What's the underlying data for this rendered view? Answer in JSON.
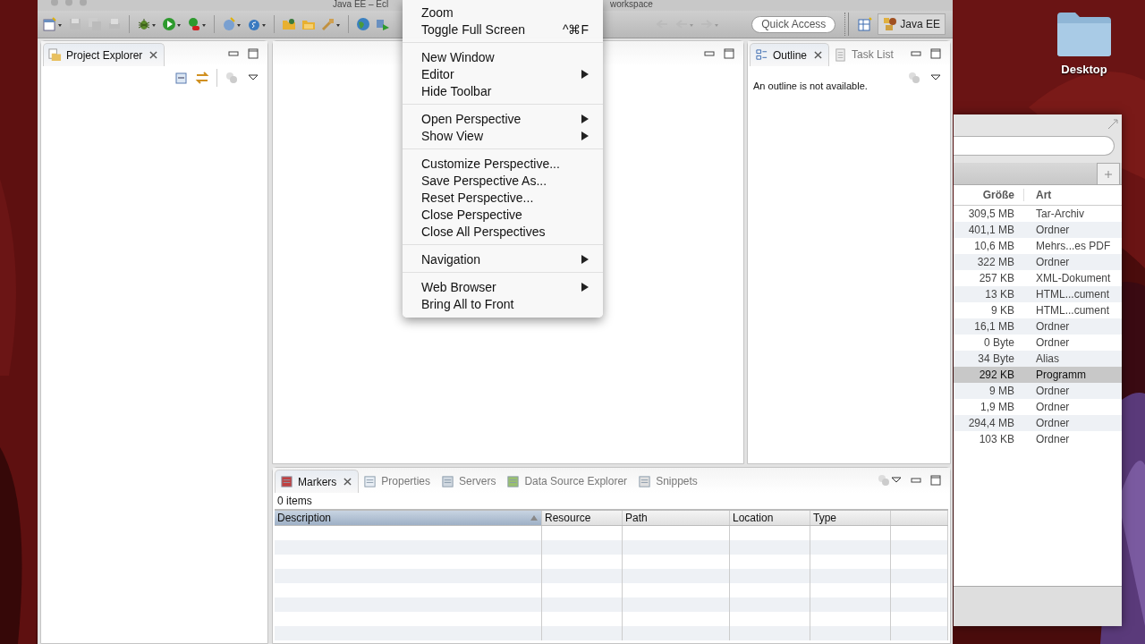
{
  "window": {
    "title_parts": [
      "Java EE – Ecl",
      "workspace"
    ]
  },
  "toolbar": {
    "quick_access": {
      "placeholder": "Quick Access"
    },
    "perspective": {
      "label": "Java EE",
      "selected": true
    }
  },
  "project_explorer": {
    "tabs": [
      {
        "label": "Project Explorer",
        "selected": true
      }
    ]
  },
  "outline": {
    "tabs": [
      {
        "label": "Outline",
        "selected": true
      },
      {
        "label": "Task List",
        "selected": false
      }
    ],
    "message": "An outline is not available."
  },
  "bottom": {
    "tabs": [
      {
        "label": "Markers",
        "selected": true
      },
      {
        "label": "Properties",
        "selected": false
      },
      {
        "label": "Servers",
        "selected": false
      },
      {
        "label": "Data Source Explorer",
        "selected": false
      },
      {
        "label": "Snippets",
        "selected": false
      }
    ],
    "count": "0 items",
    "columns": [
      {
        "label": "Description",
        "sorted": true
      },
      {
        "label": "Resource",
        "sorted": false
      },
      {
        "label": "Path",
        "sorted": false
      },
      {
        "label": "Location",
        "sorted": false
      },
      {
        "label": "Type",
        "sorted": false
      }
    ]
  },
  "menu": {
    "groups": [
      [
        {
          "label": "Zoom",
          "submenu": false
        },
        {
          "label": "Toggle Full Screen",
          "shortcut": "^⌘F",
          "submenu": false
        }
      ],
      [
        {
          "label": "New Window",
          "submenu": false
        },
        {
          "label": "Editor",
          "submenu": true
        },
        {
          "label": "Hide Toolbar",
          "submenu": false
        }
      ],
      [
        {
          "label": "Open Perspective",
          "submenu": true
        },
        {
          "label": "Show View",
          "submenu": true
        }
      ],
      [
        {
          "label": "Customize Perspective...",
          "submenu": false
        },
        {
          "label": "Save Perspective As...",
          "submenu": false
        },
        {
          "label": "Reset Perspective...",
          "submenu": false
        },
        {
          "label": "Close Perspective",
          "submenu": false
        },
        {
          "label": "Close All Perspectives",
          "submenu": false
        }
      ],
      [
        {
          "label": "Navigation",
          "submenu": true
        }
      ],
      [
        {
          "label": "Web Browser",
          "submenu": true
        },
        {
          "label": "Bring All to Front",
          "submenu": false
        }
      ]
    ]
  },
  "finder": {
    "columns": [
      "Größe",
      "Art"
    ],
    "rows": [
      {
        "size": "309,5 MB",
        "kind": "Tar-Archiv",
        "selected": false
      },
      {
        "size": "401,1 MB",
        "kind": "Ordner",
        "selected": false
      },
      {
        "size": "10,6 MB",
        "kind": "Mehrs...es PDF",
        "selected": false
      },
      {
        "size": "322 MB",
        "kind": "Ordner",
        "selected": false
      },
      {
        "size": "257 KB",
        "kind": "XML-Dokument",
        "selected": false
      },
      {
        "size": "13 KB",
        "kind": "HTML...cument",
        "selected": false
      },
      {
        "size": "9 KB",
        "kind": "HTML...cument",
        "selected": false
      },
      {
        "size": "16,1 MB",
        "kind": "Ordner",
        "selected": false
      },
      {
        "size": "0 Byte",
        "kind": "Ordner",
        "selected": false
      },
      {
        "size": "34 Byte",
        "kind": "Alias",
        "selected": false
      },
      {
        "size": "292 KB",
        "kind": "Programm",
        "selected": true
      },
      {
        "size": "9 MB",
        "kind": "Ordner",
        "selected": false
      },
      {
        "size": "1,9 MB",
        "kind": "Ordner",
        "selected": false
      },
      {
        "size": "294,4 MB",
        "kind": "Ordner",
        "selected": false
      },
      {
        "size": "103 KB",
        "kind": "Ordner",
        "selected": false
      }
    ]
  },
  "desktop": {
    "icons": [
      {
        "label": "Desktop"
      }
    ]
  }
}
